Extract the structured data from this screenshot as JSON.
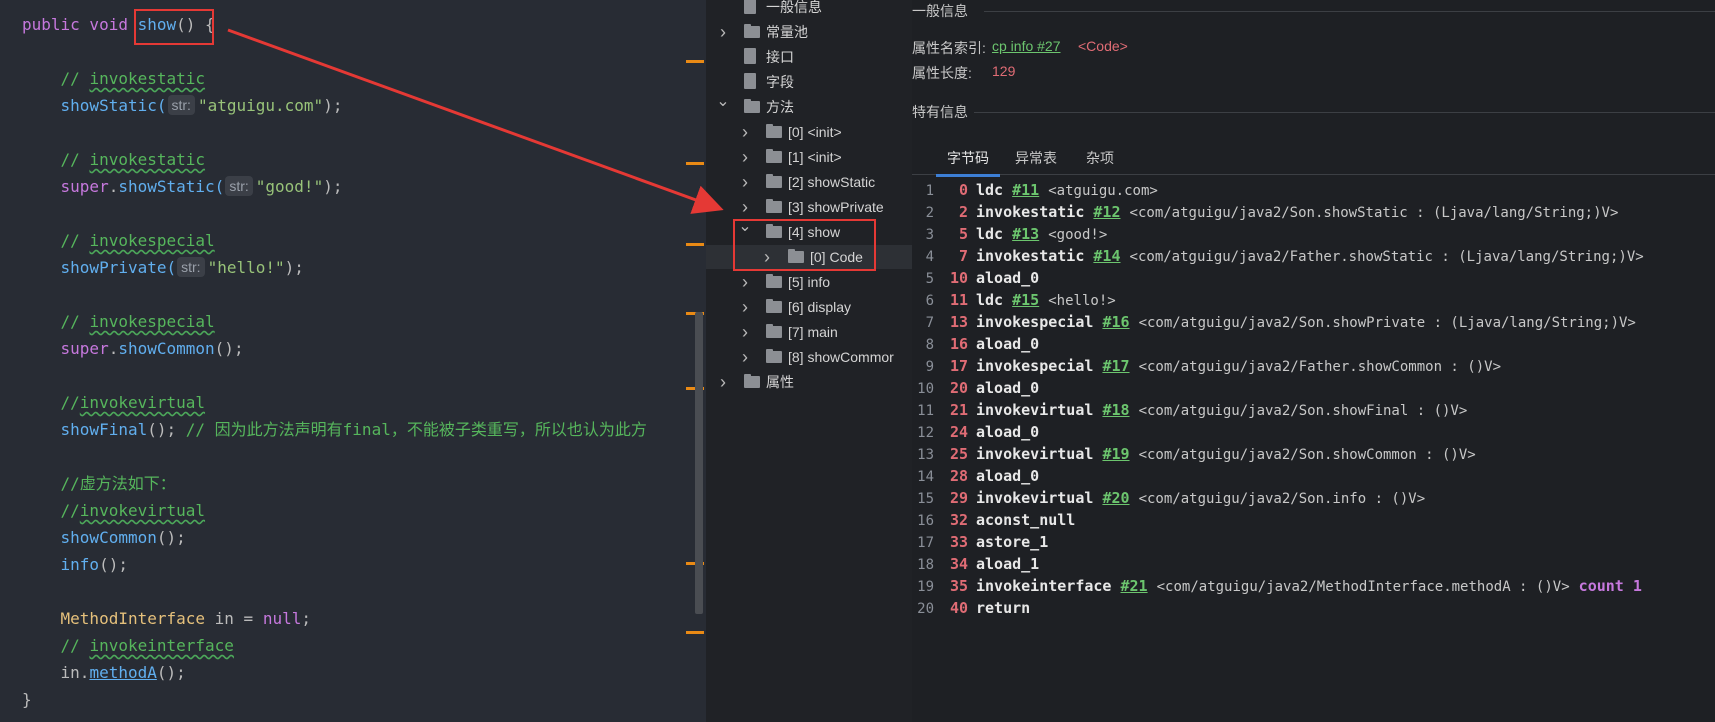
{
  "editor": {
    "lines": [
      [
        {
          "t": "public void ",
          "c": "kw"
        },
        {
          "t": "show",
          "c": "fn"
        },
        {
          "t": "() {",
          "c": "plain"
        }
      ],
      [],
      [
        {
          "t": "    // ",
          "c": "comment"
        },
        {
          "t": "invokestatic",
          "c": "comment",
          "u": true
        }
      ],
      [
        {
          "t": "    showStatic(",
          "c": "fn"
        },
        {
          "t": "str:",
          "c": "hint"
        },
        {
          "t": "\"atguigu.com\"",
          "c": "str"
        },
        {
          "t": ");",
          "c": "plain"
        }
      ],
      [],
      [
        {
          "t": "    // ",
          "c": "comment"
        },
        {
          "t": "invokestatic",
          "c": "comment",
          "u": true
        }
      ],
      [
        {
          "t": "    super",
          "c": "kw"
        },
        {
          "t": ".",
          "c": "plain"
        },
        {
          "t": "showStatic(",
          "c": "fn"
        },
        {
          "t": "str:",
          "c": "hint"
        },
        {
          "t": "\"good!\"",
          "c": "str"
        },
        {
          "t": ");",
          "c": "plain"
        }
      ],
      [],
      [
        {
          "t": "    // ",
          "c": "comment"
        },
        {
          "t": "invokespecial",
          "c": "comment",
          "u": true
        }
      ],
      [
        {
          "t": "    showPrivate(",
          "c": "fn"
        },
        {
          "t": "str:",
          "c": "hint"
        },
        {
          "t": "\"hello!\"",
          "c": "str"
        },
        {
          "t": ");",
          "c": "plain"
        }
      ],
      [],
      [
        {
          "t": "    // ",
          "c": "comment"
        },
        {
          "t": "invokespecial",
          "c": "comment",
          "u": true
        }
      ],
      [
        {
          "t": "    super",
          "c": "kw"
        },
        {
          "t": ".",
          "c": "plain"
        },
        {
          "t": "showCommon",
          "c": "fn"
        },
        {
          "t": "();",
          "c": "plain"
        }
      ],
      [],
      [
        {
          "t": "    //",
          "c": "comment"
        },
        {
          "t": "invokevirtual",
          "c": "comment",
          "u": true
        }
      ],
      [
        {
          "t": "    showFinal",
          "c": "fn"
        },
        {
          "t": "(); ",
          "c": "plain"
        },
        {
          "t": "// 因为此方法声明有final，不能被子类重写，所以也认为此方",
          "c": "comment"
        }
      ],
      [],
      [
        {
          "t": "    //虚方法如下：",
          "c": "comment"
        }
      ],
      [
        {
          "t": "    //",
          "c": "comment"
        },
        {
          "t": "invokevirtual",
          "c": "comment",
          "u": true
        }
      ],
      [
        {
          "t": "    showCommon",
          "c": "fn"
        },
        {
          "t": "();",
          "c": "plain"
        }
      ],
      [
        {
          "t": "    info",
          "c": "fn"
        },
        {
          "t": "();",
          "c": "plain"
        }
      ],
      [],
      [
        {
          "t": "    MethodInterface ",
          "c": "type"
        },
        {
          "t": "in = ",
          "c": "plain"
        },
        {
          "t": "null",
          "c": "null"
        },
        {
          "t": ";",
          "c": "plain"
        }
      ],
      [
        {
          "t": "    // ",
          "c": "comment"
        },
        {
          "t": "invokeinterface",
          "c": "comment",
          "u": true
        }
      ],
      [
        {
          "t": "    in.",
          "c": "plain"
        },
        {
          "t": "methodA",
          "c": "fn",
          "u2": true
        },
        {
          "t": "();",
          "c": "plain"
        }
      ],
      [
        {
          "t": "}",
          "c": "plain"
        }
      ]
    ]
  },
  "tree": {
    "items": [
      {
        "label": "一般信息",
        "depth": 0,
        "expand": "none",
        "icon": "file"
      },
      {
        "label": "常量池",
        "depth": 0,
        "expand": "collapsed",
        "icon": "folder"
      },
      {
        "label": "接口",
        "depth": 0,
        "expand": "none",
        "icon": "file"
      },
      {
        "label": "字段",
        "depth": 0,
        "expand": "none",
        "icon": "file"
      },
      {
        "label": "方法",
        "depth": 0,
        "expand": "expanded",
        "icon": "folder"
      },
      {
        "label": "[0] <init>",
        "depth": 1,
        "expand": "collapsed",
        "icon": "folder"
      },
      {
        "label": "[1] <init>",
        "depth": 1,
        "expand": "collapsed",
        "icon": "folder"
      },
      {
        "label": "[2] showStatic",
        "depth": 1,
        "expand": "collapsed",
        "icon": "folder"
      },
      {
        "label": "[3] showPrivate",
        "depth": 1,
        "expand": "collapsed",
        "icon": "folder"
      },
      {
        "label": "[4] show",
        "depth": 1,
        "expand": "expanded",
        "icon": "folder"
      },
      {
        "label": "[0] Code",
        "depth": 2,
        "expand": "collapsed",
        "icon": "folder",
        "selected": true
      },
      {
        "label": "[5] info",
        "depth": 1,
        "expand": "collapsed",
        "icon": "folder"
      },
      {
        "label": "[6] display",
        "depth": 1,
        "expand": "collapsed",
        "icon": "folder"
      },
      {
        "label": "[7] main",
        "depth": 1,
        "expand": "collapsed",
        "icon": "folder"
      },
      {
        "label": "[8] showCommor",
        "depth": 1,
        "expand": "collapsed",
        "icon": "folder"
      },
      {
        "label": "属性",
        "depth": 0,
        "expand": "collapsed",
        "icon": "folder"
      }
    ]
  },
  "info": {
    "general_title": "一般信息",
    "name_index_label": "属性名索引:",
    "name_index_link": "cp info #27",
    "name_index_tag": "<Code>",
    "length_label": "属性长度:",
    "length_value": "129",
    "specific_title": "特有信息",
    "tabs": [
      "字节码",
      "异常表",
      "杂项"
    ],
    "active_tab": 0,
    "bytecode": [
      {
        "ln": "1",
        "off": "0",
        "op": "ldc",
        "ref": "#11",
        "arg": "<atguigu.com>"
      },
      {
        "ln": "2",
        "off": "2",
        "op": "invokestatic",
        "ref": "#12",
        "arg": "<com/atguigu/java2/Son.showStatic : (Ljava/lang/String;)V>"
      },
      {
        "ln": "3",
        "off": "5",
        "op": "ldc",
        "ref": "#13",
        "arg": "<good!>"
      },
      {
        "ln": "4",
        "off": "7",
        "op": "invokestatic",
        "ref": "#14",
        "arg": "<com/atguigu/java2/Father.showStatic : (Ljava/lang/String;)V>"
      },
      {
        "ln": "5",
        "off": "10",
        "op": "aload_0",
        "ref": "",
        "arg": ""
      },
      {
        "ln": "6",
        "off": "11",
        "op": "ldc",
        "ref": "#15",
        "arg": "<hello!>"
      },
      {
        "ln": "7",
        "off": "13",
        "op": "invokespecial",
        "ref": "#16",
        "arg": "<com/atguigu/java2/Son.showPrivate : (Ljava/lang/String;)V>"
      },
      {
        "ln": "8",
        "off": "16",
        "op": "aload_0",
        "ref": "",
        "arg": ""
      },
      {
        "ln": "9",
        "off": "17",
        "op": "invokespecial",
        "ref": "#17",
        "arg": "<com/atguigu/java2/Father.showCommon : ()V>"
      },
      {
        "ln": "10",
        "off": "20",
        "op": "aload_0",
        "ref": "",
        "arg": ""
      },
      {
        "ln": "11",
        "off": "21",
        "op": "invokevirtual",
        "ref": "#18",
        "arg": "<com/atguigu/java2/Son.showFinal : ()V>"
      },
      {
        "ln": "12",
        "off": "24",
        "op": "aload_0",
        "ref": "",
        "arg": ""
      },
      {
        "ln": "13",
        "off": "25",
        "op": "invokevirtual",
        "ref": "#19",
        "arg": "<com/atguigu/java2/Son.showCommon : ()V>"
      },
      {
        "ln": "14",
        "off": "28",
        "op": "aload_0",
        "ref": "",
        "arg": ""
      },
      {
        "ln": "15",
        "off": "29",
        "op": "invokevirtual",
        "ref": "#20",
        "arg": "<com/atguigu/java2/Son.info : ()V>"
      },
      {
        "ln": "16",
        "off": "32",
        "op": "aconst_null",
        "ref": "",
        "arg": ""
      },
      {
        "ln": "17",
        "off": "33",
        "op": "astore_1",
        "ref": "",
        "arg": ""
      },
      {
        "ln": "18",
        "off": "34",
        "op": "aload_1",
        "ref": "",
        "arg": ""
      },
      {
        "ln": "19",
        "off": "35",
        "op": "invokeinterface",
        "ref": "#21",
        "arg": "<com/atguigu/java2/MethodInterface.methodA : ()V>",
        "extra": "count 1"
      },
      {
        "ln": "20",
        "off": "40",
        "op": "return",
        "ref": "",
        "arg": ""
      }
    ]
  },
  "colors": {
    "annotation_red": "#e53935",
    "accent_blue": "#3d7fd6",
    "link_green": "#6cc56e",
    "offset_red": "#e06c75"
  }
}
